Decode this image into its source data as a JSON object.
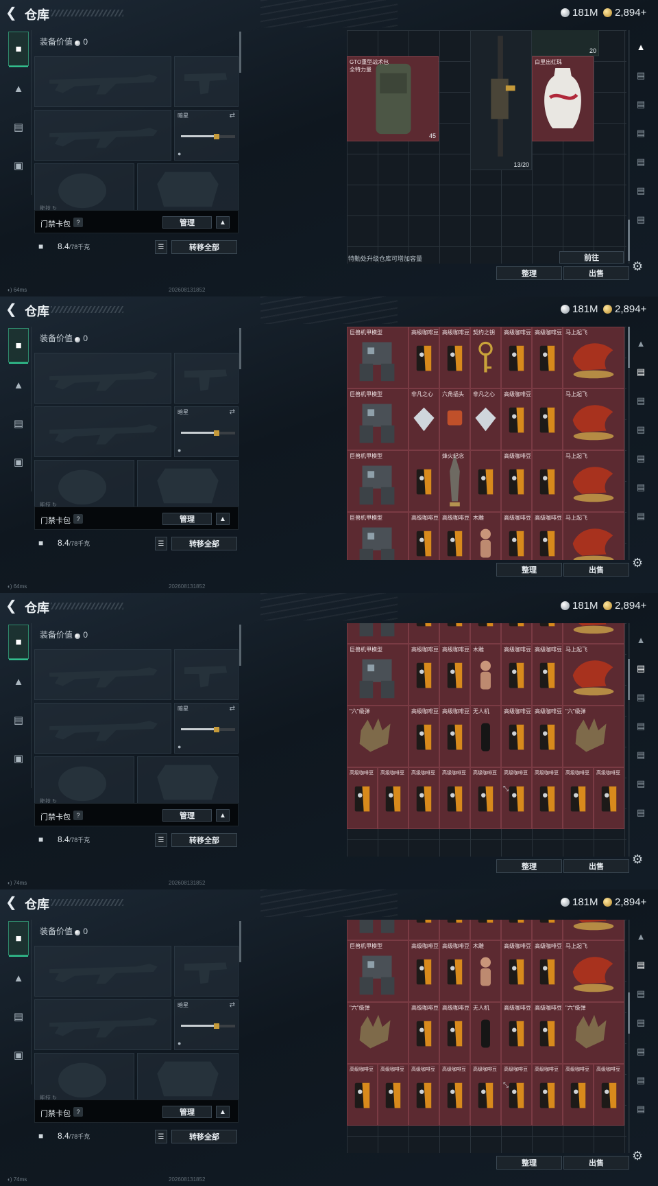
{
  "common": {
    "title": "仓库",
    "silver": "181M",
    "gold": "2,894+",
    "loadout_title": "装备价值",
    "loadout_value": "0",
    "knife_name": "暗星",
    "keybar_label": "门禁卡包",
    "help": "?",
    "manage": "管理",
    "weight": "8.4",
    "weight_max": "/78千克",
    "transfer_all": "转移全部",
    "sort": "整理",
    "sell": "出售",
    "build_stamp": "202608131852",
    "behind_text": "能技 ↻"
  },
  "frames": [
    {
      "ping": "64ms",
      "view": "inventory",
      "upgrade_hint": "特勤处升级仓库可增加容量",
      "goto": "前往",
      "items": {
        "backpack_name": "GTO重型战术包",
        "backpack_sub": "全特力量",
        "backpack_count": "45",
        "rifle_count": "13/20",
        "top_count": "20",
        "vase_name": "白里出红珠"
      }
    },
    {
      "ping": "64ms",
      "view": "loot",
      "rows": [
        [
          "巨兽机甲模型",
          "高级咖啡豆",
          "高级咖啡豆",
          "契约之钥",
          "高级咖啡豆",
          "高级咖啡豆",
          "马上起飞"
        ],
        [
          "巨兽机甲模型",
          "非凡之心",
          "六角插头",
          "非凡之心",
          "高级咖啡豆",
          "",
          "马上起飞"
        ],
        [
          "巨兽机甲模型",
          "",
          "烽火纪念",
          "",
          "高级咖啡豆",
          "",
          "马上起飞"
        ],
        [
          "巨兽机甲模型",
          "高级咖啡豆",
          "高级咖啡豆",
          "木雕",
          "高级咖啡豆",
          "高级咖啡豆",
          "马上起飞"
        ]
      ]
    },
    {
      "ping": "74ms",
      "view": "loot",
      "rows": [
        [
          "",
          "",
          "",
          "",
          "",
          "",
          ""
        ],
        [
          "巨兽机甲模型",
          "高级咖啡豆",
          "高级咖啡豆",
          "木雕",
          "高级咖啡豆",
          "高级咖啡豆",
          "马上起飞"
        ],
        [
          "\"六\"级弹",
          "高级咖啡豆",
          "高级咖啡豆",
          "无人机",
          "高级咖啡豆",
          "高级咖啡豆",
          "\"六\"级弹"
        ],
        [
          "高级咖啡豆",
          "高级咖啡豆",
          "高级咖啡豆",
          "高级咖啡豆",
          "高级咖啡豆",
          "高级咖啡豆",
          "高级咖啡豆",
          "高级咖啡豆",
          "高级咖啡豆"
        ]
      ]
    },
    {
      "ping": "74ms",
      "view": "loot",
      "rows": [
        [
          "",
          "",
          "",
          "",
          "",
          "",
          ""
        ],
        [
          "巨兽机甲模型",
          "高级咖啡豆",
          "高级咖啡豆",
          "木雕",
          "高级咖啡豆",
          "高级咖啡豆",
          "马上起飞"
        ],
        [
          "\"六\"级弹",
          "高级咖啡豆",
          "高级咖啡豆",
          "无人机",
          "高级咖啡豆",
          "高级咖啡豆",
          "\"六\"级弹"
        ],
        [
          "高级咖啡豆",
          "高级咖啡豆",
          "高级咖啡豆",
          "高级咖啡豆",
          "高级咖啡豆",
          "高级咖啡豆",
          "高级咖啡豆",
          "高级咖啡豆",
          "高级咖啡豆"
        ]
      ]
    }
  ],
  "colors": {
    "loot_bg": "#5c2a31",
    "accent_green": "#2fbf8c"
  },
  "icons": [
    "back-arrow-icon",
    "silver-coin-icon",
    "gold-coin-icon",
    "gun-icon",
    "helmet-icon",
    "clipboard-icon",
    "briefcase-icon",
    "lock-icon",
    "swap-icon",
    "list-icon",
    "gear-icon"
  ]
}
